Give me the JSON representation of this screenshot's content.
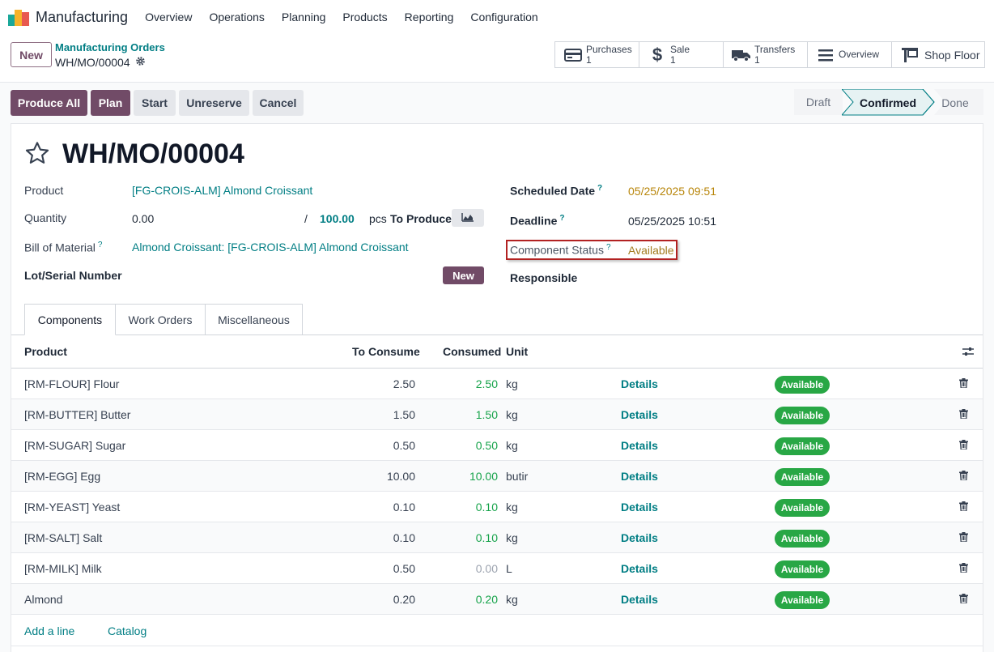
{
  "app": {
    "name": "Manufacturing"
  },
  "nav": {
    "items": [
      "Overview",
      "Operations",
      "Planning",
      "Products",
      "Reporting",
      "Configuration"
    ]
  },
  "control": {
    "new_label": "New",
    "breadcrumb_parent": "Manufacturing Orders",
    "breadcrumb_current": "WH/MO/00004",
    "smart_buttons": [
      {
        "label": "Purchases",
        "count": "1",
        "icon": "credit-card-icon"
      },
      {
        "label": "Sale",
        "count": "1",
        "icon": "dollar-icon"
      },
      {
        "label": "Transfers",
        "count": "1",
        "icon": "truck-icon"
      },
      {
        "label": "Overview",
        "icon": "list-icon"
      },
      {
        "label": "Shop Floor",
        "icon": "tablet-icon"
      }
    ]
  },
  "actions": {
    "produce_all": "Produce All",
    "plan": "Plan",
    "start": "Start",
    "unreserve": "Unreserve",
    "cancel": "Cancel"
  },
  "statusbar": {
    "stages": [
      "Draft",
      "Confirmed",
      "Done"
    ],
    "current": "Confirmed"
  },
  "record": {
    "title": "WH/MO/00004",
    "product_label": "Product",
    "product_value": "[FG-CROIS-ALM] Almond Croissant",
    "quantity_label": "Quantity",
    "quantity_value": "0.00",
    "quantity_sep": "/",
    "quantity_target": "100.00",
    "quantity_unit": "pcs",
    "to_produce": "To Produce",
    "bom_label": "Bill of Material",
    "bom_value": "Almond Croissant: [FG-CROIS-ALM] Almond Croissant",
    "lot_label": "Lot/Serial Number",
    "lot_new": "New",
    "scheduled_label": "Scheduled Date",
    "scheduled_value": "05/25/2025 09:51",
    "deadline_label": "Deadline",
    "deadline_value": "05/25/2025 10:51",
    "component_status_label": "Component Status",
    "component_status_value": "Available",
    "responsible_label": "Responsible",
    "help_mark": "?"
  },
  "tabs": [
    "Components",
    "Work Orders",
    "Miscellaneous"
  ],
  "table": {
    "headers": {
      "product": "Product",
      "to_consume": "To Consume",
      "consumed": "Consumed",
      "unit": "Unit"
    },
    "rows": [
      {
        "product": "[RM-FLOUR] Flour",
        "to_consume": "2.50",
        "consumed": "2.50",
        "unit": "kg",
        "details": "Details",
        "status": "Available"
      },
      {
        "product": "[RM-BUTTER] Butter",
        "to_consume": "1.50",
        "consumed": "1.50",
        "unit": "kg",
        "details": "Details",
        "status": "Available"
      },
      {
        "product": "[RM-SUGAR] Sugar",
        "to_consume": "0.50",
        "consumed": "0.50",
        "unit": "kg",
        "details": "Details",
        "status": "Available"
      },
      {
        "product": "[RM-EGG] Egg",
        "to_consume": "10.00",
        "consumed": "10.00",
        "unit": "butir",
        "details": "Details",
        "status": "Available"
      },
      {
        "product": "[RM-YEAST] Yeast",
        "to_consume": "0.10",
        "consumed": "0.10",
        "unit": "kg",
        "details": "Details",
        "status": "Available"
      },
      {
        "product": "[RM-SALT] Salt",
        "to_consume": "0.10",
        "consumed": "0.10",
        "unit": "kg",
        "details": "Details",
        "status": "Available"
      },
      {
        "product": "[RM-MILK] Milk",
        "to_consume": "0.50",
        "consumed": "0.00",
        "unit": "L",
        "details": "Details",
        "status": "Available"
      },
      {
        "product": "Almond",
        "to_consume": "0.20",
        "consumed": "0.20",
        "unit": "kg",
        "details": "Details",
        "status": "Available"
      }
    ],
    "add_line": "Add a line",
    "catalog": "Catalog"
  },
  "colors": {
    "brand": "#714b67",
    "link": "#017e84",
    "success": "#28a745",
    "warning": "#b8860b"
  }
}
